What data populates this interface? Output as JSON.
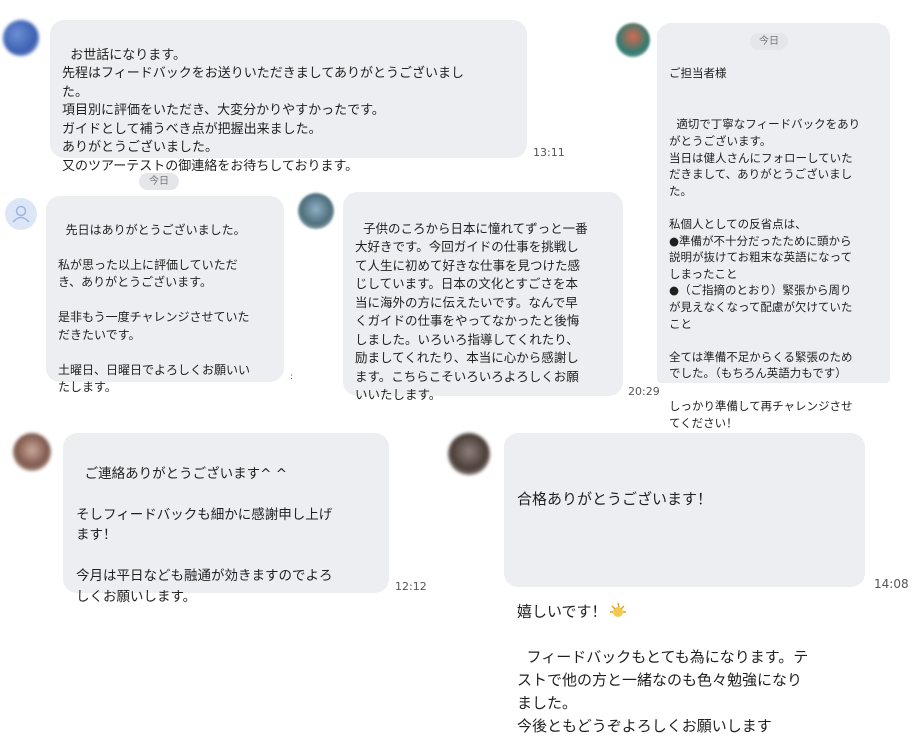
{
  "colors": {
    "bubble": "#eceef1",
    "background": "#ffffff",
    "timestamp": "#555555",
    "pill": "#e4e6ea"
  },
  "chat1": {
    "message": "お世話になります。\n先程はフィードバックをお送りいただきましてありがとうございまし\nた。\n項目別に評価をいただき、大変分かりやすかったです。\nガイドとして補うべき点が把握出来ました。\nありがとうございました。\n又のツアーテストの御連絡をお待ちしております。",
    "time": "13:11"
  },
  "chat2": {
    "pill": "今日",
    "message": "先日はありがとうございました。\n\n私が思った以上に評価していただ\nき、ありがとうございます。\n\n是非もう一度チャレンジさせていた\nだきたいです。\n\n土曜日、日曜日でよろしくお願いい\nたします。",
    "side_mark": ":"
  },
  "chat3": {
    "message": "子供のころから日本に憧れてずっと一番\n大好きです。今回ガイドの仕事を挑戦し\nて人生に初めて好きな仕事を見つけた感\nじしています。日本の文化とすごさを本\n当に海外の方に伝えたいです。なんで早\nくガイドの仕事をやってなかったと後悔\nしました。いろいろ指導してくれたり、\n励ましてくれたり、本当に心から感謝し\nます。こちらこそいろいろよろしくお願\nいいたします。",
    "time": "20:29"
  },
  "chat4": {
    "greeting": "ご担当者様",
    "pill": "今日",
    "message": "適切で丁寧なフィードバックをあり\nがとうございます。\n当日は健人さんにフォローしていた\nだきまして、ありがとうございまし\nた。\n\n私個人としての反省点は、\n●準備が不十分だったために頭から\n説明が抜けてお粗末な英語になって\nしまったこと\n●（ご指摘のとおり）緊張から周り\nが見えなくなって配慮が欠けていた\nこと\n\n全ては準備不足からくる緊張のため\nでした。（もちろん英語力もです）\n\nしっかり準備して再チャレンジさせ\nてください！"
  },
  "chat5": {
    "message": "ご連絡ありがとうございます^ ^\n\nそしフィードバックも細かに感謝申し上げ\nます！\n\n今月は平日なども融通が効きますのでよろ\nしくお願いします。",
    "time": "12:12"
  },
  "chat6": {
    "line1": "合格ありがとうございます！",
    "line2": "嬉しいです！",
    "emoji_icon": "party-icon",
    "message": "フィードバックもとても為になります。テ\nストで他の方と一緒なのも色々勉強になり\nました。\n今後ともどうぞよろしくお願いします",
    "time": "14:08"
  }
}
